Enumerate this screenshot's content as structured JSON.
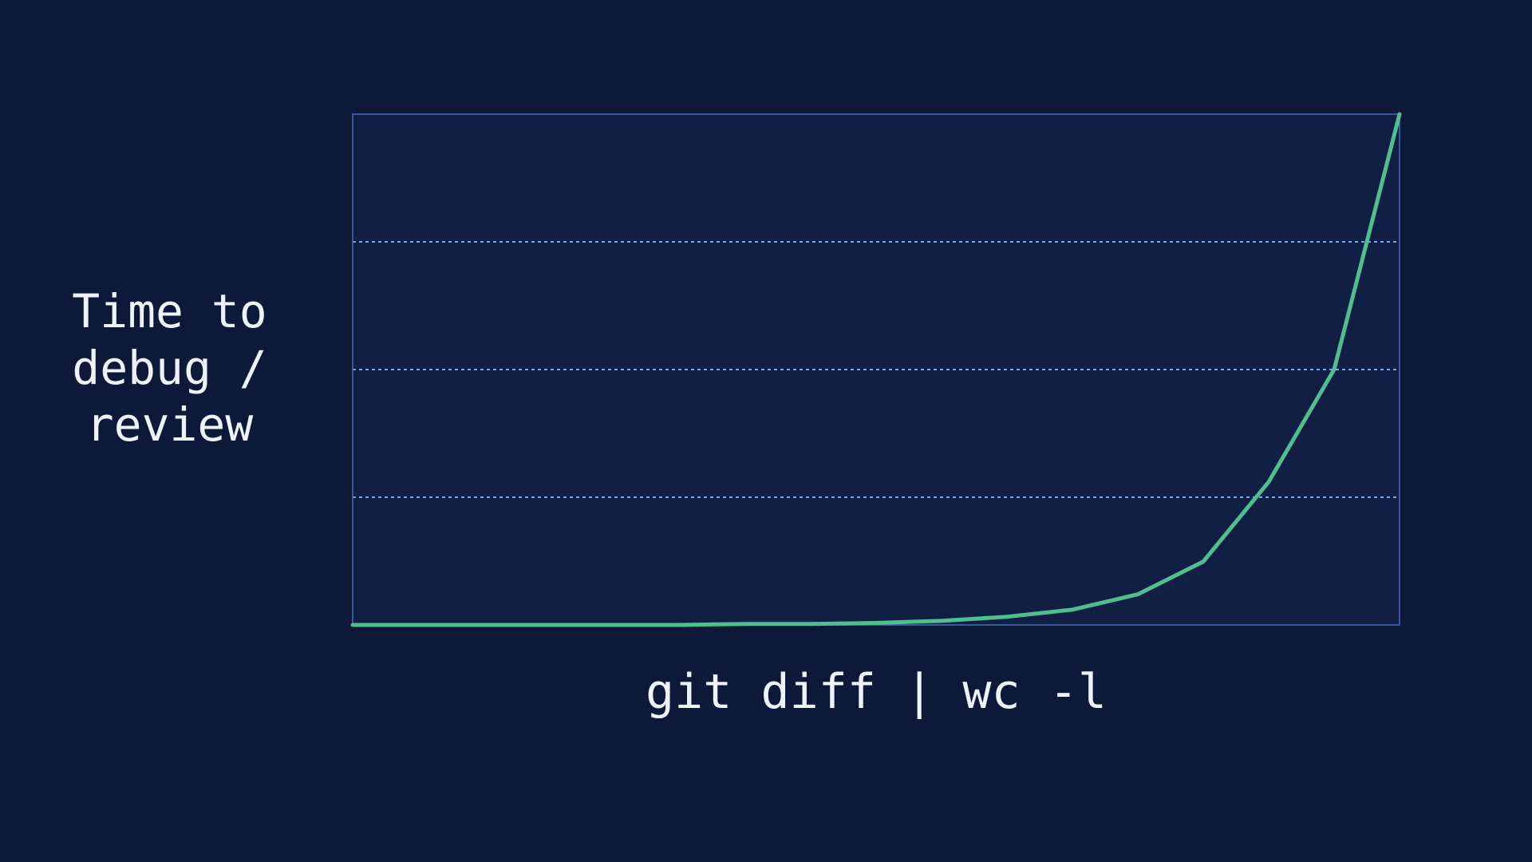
{
  "chart_data": {
    "type": "line",
    "title": "",
    "ylabel_lines": [
      "Time to",
      "debug /",
      "review"
    ],
    "xlabel": "git diff | wc -l",
    "x": [
      0,
      1,
      2,
      3,
      4,
      5,
      6,
      7,
      8,
      9,
      10,
      11,
      12,
      13,
      14,
      15,
      16
    ],
    "series": [
      {
        "values": [
          0.0,
          0.0,
          0.0,
          0.0,
          0.0,
          0.0,
          0.1,
          0.1,
          0.2,
          0.4,
          0.8,
          1.5,
          3.0,
          6.2,
          14.0,
          25.0,
          50.0
        ]
      }
    ],
    "xlim": [
      0,
      16
    ],
    "ylim": [
      0,
      50
    ],
    "y_gridlines": [
      12.5,
      25,
      37.5
    ],
    "grid": "horizontal dashed",
    "colors": {
      "background": "#0e1838",
      "plot_background": "#111f44",
      "frame": "#4a6ab8",
      "grid": "#7aa6e8",
      "line": "#4fc08d",
      "text": "#eef2fa"
    }
  }
}
